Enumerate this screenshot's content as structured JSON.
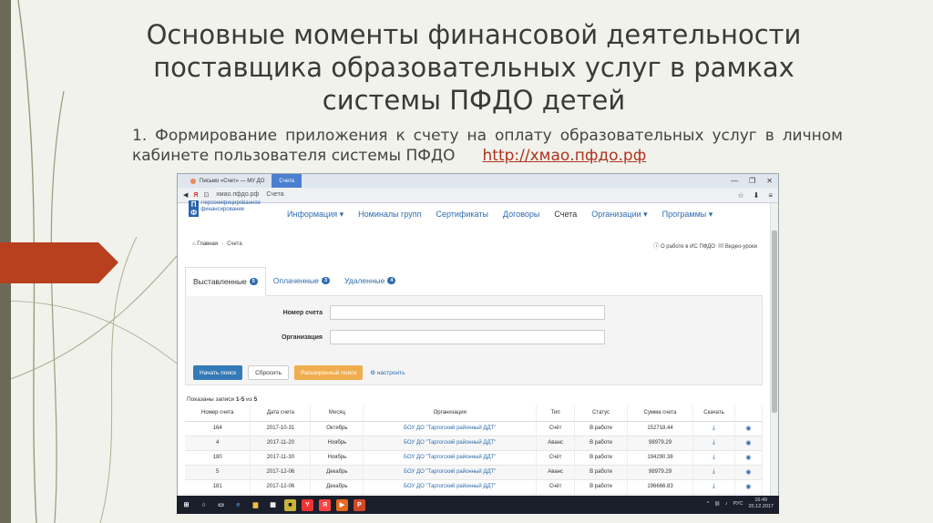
{
  "slide": {
    "title": "Основные моменты финансовой деятельности поставщика образовательных услуг в рамках системы ПФДО детей",
    "subtitle": "1. Формирование приложения к счету на оплату образовательных услуг в личном кабинете пользователя системы ПФДО",
    "link": "http://хмао.пфдо.рф"
  },
  "browser": {
    "tabs": [
      "Письмо «Счет» — МУ ДО",
      "Счета"
    ],
    "url": "хмао.пфдо.рф",
    "page_title": "Счета",
    "controls": [
      "—",
      "❐",
      "✕"
    ]
  },
  "site": {
    "logo_mark": "П Ф Д О",
    "logo_text": "Персонифицированное финансирование",
    "nav": [
      {
        "label": "Информация ▾"
      },
      {
        "label": "Номиналы групп"
      },
      {
        "label": "Сертификаты"
      },
      {
        "label": "Договоры"
      },
      {
        "label": "Счета"
      },
      {
        "label": "Организации ▾"
      },
      {
        "label": "Программы ▾"
      }
    ],
    "breadcrumb_home": "Главная",
    "breadcrumb_current": "Счета",
    "about_link": "О работе в ИС ПФДО",
    "video_link": "Видео-уроки",
    "tabs": [
      {
        "label": "Выставленные",
        "count": "5"
      },
      {
        "label": "Оплаченные",
        "count": "3"
      },
      {
        "label": "Удаленные",
        "count": "4"
      }
    ],
    "filter": {
      "invoice_label": "Номер счета",
      "org_label": "Организация",
      "search_btn": "Начать поиск",
      "reset_btn": "Сбросить",
      "advanced_btn": "Расширенный поиск",
      "settings_link": "настроить"
    },
    "shown_prefix": "Показаны записи ",
    "shown_range": "1-5",
    "shown_mid": " из ",
    "shown_total": "5",
    "table": {
      "headers": [
        "Номер счета",
        "Дата счета",
        "Месяц",
        "Организация",
        "Тип",
        "Статус",
        "Сумма счета",
        "Скачать",
        ""
      ],
      "rows": [
        [
          "164",
          "2017-10-31",
          "Октябрь",
          "БОУ ДО \"Таргогский районный ДДТ\"",
          "Счёт",
          "В работе",
          "152718.44"
        ],
        [
          "4",
          "2017-11-20",
          "Ноябрь",
          "БОУ ДО \"Таргогский районный ДДТ\"",
          "Аванс",
          "В работе",
          "98979.29"
        ],
        [
          "180",
          "2017-11-30",
          "Ноябрь",
          "БОУ ДО \"Таргогский районный ДДТ\"",
          "Счёт",
          "В работе",
          "194290.38"
        ],
        [
          "5",
          "2017-12-06",
          "Декабрь",
          "БОУ ДО \"Таргогский районный ДДТ\"",
          "Аванс",
          "В работе",
          "98979.29"
        ],
        [
          "181",
          "2017-12-06",
          "Декабрь",
          "БОУ ДО \"Таргогский районный ДДТ\"",
          "Счёт",
          "В работе",
          "196666.83"
        ]
      ]
    }
  },
  "taskbar": {
    "lang": "РУС",
    "time": "16:49",
    "date": "20.12.2017"
  },
  "colors": {
    "accent": "#2d6db0",
    "arrow": "#b8401f",
    "left_bar": "#6c6a57"
  }
}
